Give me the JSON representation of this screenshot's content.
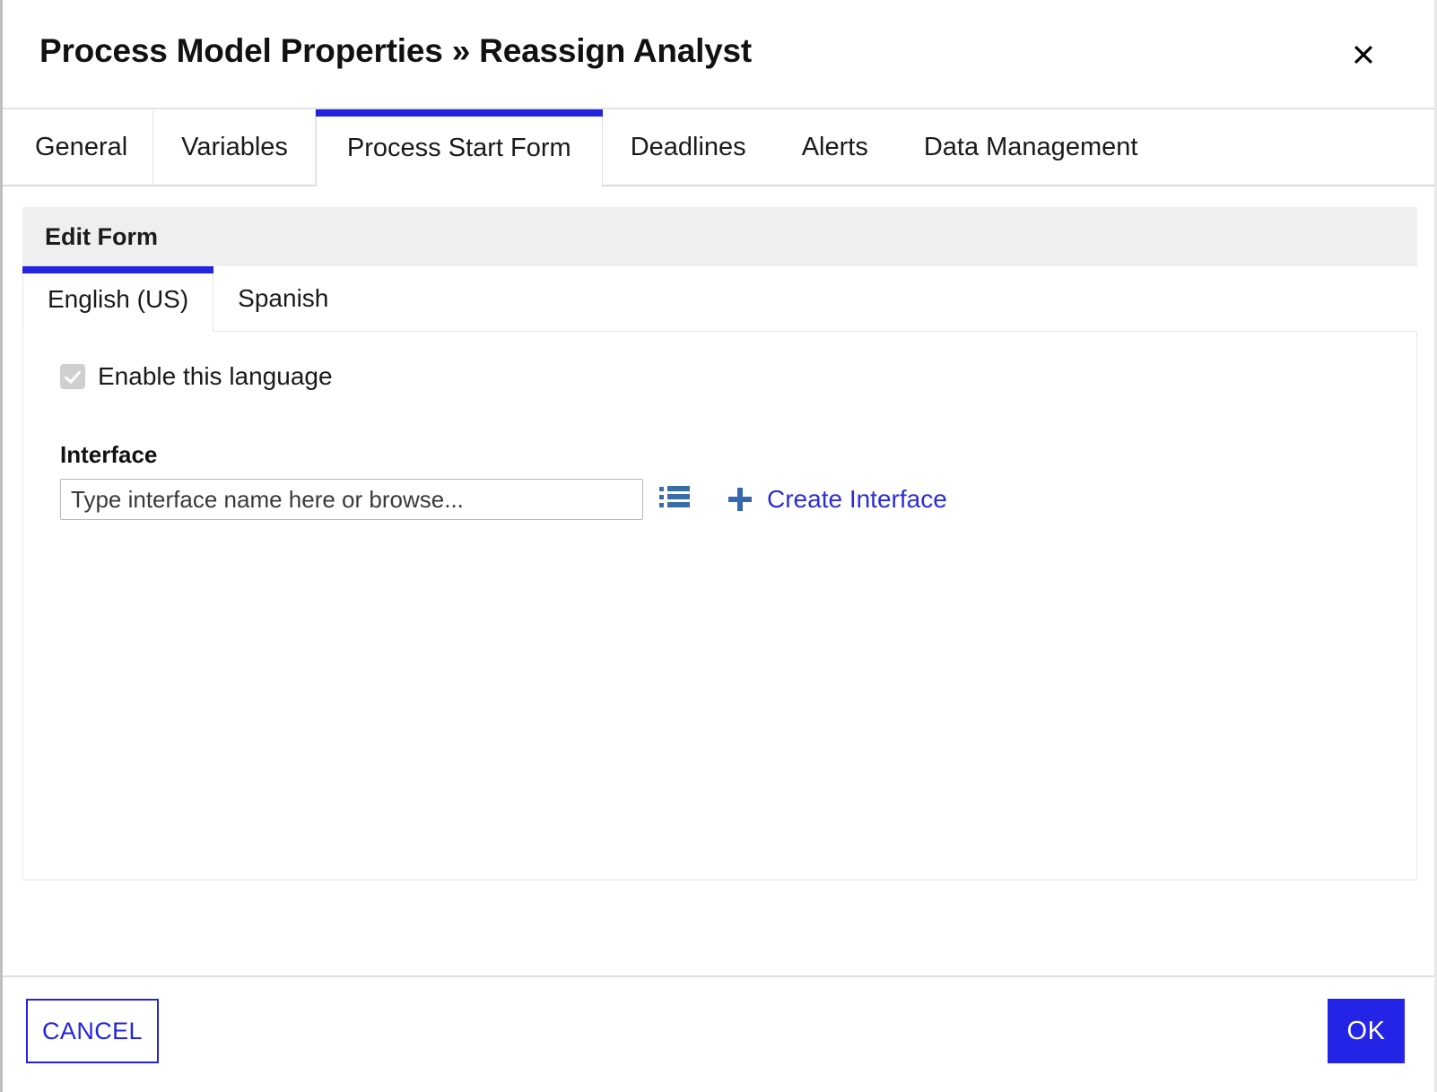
{
  "dialog": {
    "title": "Process Model Properties » Reassign Analyst",
    "close_icon": "close-icon"
  },
  "tabs": [
    {
      "label": "General",
      "active": false
    },
    {
      "label": "Variables",
      "active": false
    },
    {
      "label": "Process Start Form",
      "active": true
    },
    {
      "label": "Deadlines",
      "active": false
    },
    {
      "label": "Alerts",
      "active": false
    },
    {
      "label": "Data Management",
      "active": false
    }
  ],
  "panel": {
    "header": "Edit Form",
    "language_tabs": [
      {
        "label": "English (US)",
        "active": true
      },
      {
        "label": "Spanish",
        "active": false
      }
    ],
    "enable_language": {
      "label": "Enable this language",
      "checked": true,
      "disabled": true
    },
    "interface": {
      "label": "Interface",
      "value": "",
      "placeholder": "Type interface name here or browse...",
      "browse_icon": "list-browse-icon",
      "create_icon": "plus-icon",
      "create_label": "Create Interface"
    }
  },
  "footer": {
    "cancel_label": "CANCEL",
    "ok_label": "OK"
  },
  "colors": {
    "accent_blue": "#2424e0",
    "ok_button": "#2424e6",
    "link_blue": "#2e2ed4",
    "icon_blue": "#3a6ea5",
    "plus_blue": "#3767b0",
    "panel_header_grey": "#efefef",
    "checkbox_grey": "#cfcfcf"
  }
}
